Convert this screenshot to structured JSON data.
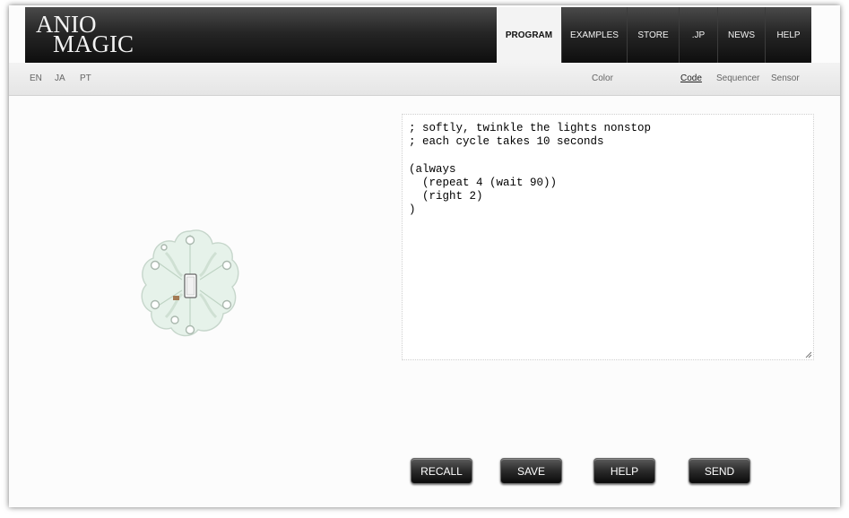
{
  "brand": {
    "line1": "ANIO",
    "line2": "MAGIC"
  },
  "nav": [
    {
      "label": "PROGRAM",
      "active": true
    },
    {
      "label": "EXAMPLES",
      "active": false
    },
    {
      "label": "STORE",
      "active": false
    },
    {
      "label": ".JP",
      "active": false
    },
    {
      "label": "NEWS",
      "active": false
    },
    {
      "label": "HELP",
      "active": false
    }
  ],
  "languages": [
    "EN",
    "JA",
    "PT"
  ],
  "modes": [
    {
      "label": "Color",
      "active": false
    },
    {
      "label": "Code",
      "active": true
    },
    {
      "label": "Sequencer",
      "active": false
    },
    {
      "label": "Sensor",
      "active": false
    }
  ],
  "editor": {
    "code": "; softly, twinkle the lights nonstop\n; each cycle takes 10 seconds\n\n(always\n  (repeat 4 (wait 90))\n  (right 2)\n)"
  },
  "buttons": {
    "recall": "RECALL",
    "save": "SAVE",
    "help": "HELP",
    "send": "SEND"
  },
  "colors": {
    "board": "#e6f2ea",
    "nav_bg": "#1c1c1c",
    "nav_active": "#f3f3f3"
  }
}
